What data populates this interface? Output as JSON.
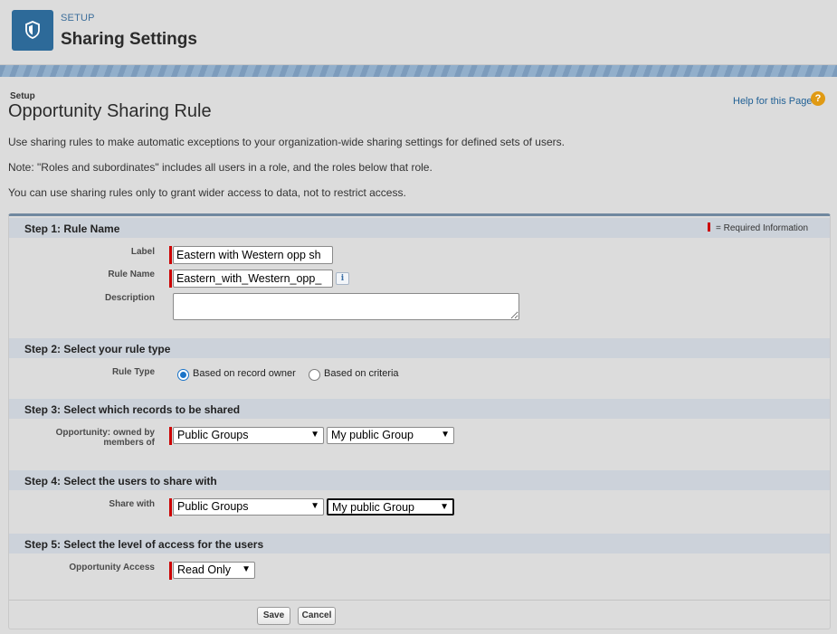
{
  "header": {
    "section_label": "SETUP",
    "app_title": "Sharing Settings",
    "app_icon": "shield-icon"
  },
  "page": {
    "breadcrumb": "Setup",
    "title": "Opportunity Sharing Rule",
    "help_link": "Help for this Page",
    "help_icon_glyph": "?"
  },
  "intro": [
    "Use sharing rules to make automatic exceptions to your organization-wide sharing settings for defined sets of users.",
    "Note: \"Roles and subordinates\" includes all users in a role, and the roles below that role.",
    "You can use sharing rules only to grant wider access to data, not to restrict access."
  ],
  "required_legend": "= Required Information",
  "step1": {
    "title": "Step 1: Rule Name",
    "label_label": "Label",
    "label_value": "Eastern with Western opp sh",
    "rulename_label": "Rule Name",
    "rulename_value": "Eastern_with_Western_opp_",
    "info_glyph": "i",
    "description_label": "Description",
    "description_value": ""
  },
  "step2": {
    "title": "Step 2: Select your rule type",
    "ruletype_label": "Rule Type",
    "option_owner": "Based on record owner",
    "option_criteria": "Based on criteria",
    "selected": "owner"
  },
  "step3": {
    "title": "Step 3: Select which records to be shared",
    "owned_label_line1": "Opportunity: owned by",
    "owned_label_line2": "members of",
    "type_select": "Public Groups",
    "group_select": "My public Group"
  },
  "step4": {
    "title": "Step 4: Select the users to share with",
    "sharewith_label": "Share with",
    "type_select": "Public Groups",
    "group_select": "My public Group"
  },
  "step5": {
    "title": "Step 5: Select the level of access for the users",
    "access_label": "Opportunity Access",
    "access_select": "Read Only"
  },
  "buttons": {
    "save": "Save",
    "cancel": "Cancel"
  },
  "colors": {
    "required_bar": "#cc0000",
    "section_header": "#ccd2da",
    "app_icon_bg": "#2d6a99",
    "help_icon_bg": "#e09a14"
  }
}
